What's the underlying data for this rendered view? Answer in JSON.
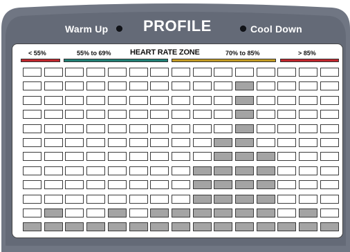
{
  "header": {
    "warm_up_label": "Warm Up",
    "title": "PROFILE",
    "cool_down_label": "Cool Down"
  },
  "zones": {
    "title": "HEART RATE ZONE",
    "items": [
      {
        "label": "< 55%",
        "color": "#c0252c"
      },
      {
        "label": "55% to 69%",
        "color": "#1f7f74"
      },
      {
        "label": "70% to 85%",
        "color": "#c29a22"
      },
      {
        "label": "> 85%",
        "color": "#c0252c"
      }
    ]
  },
  "profile": {
    "columns": 15,
    "rows": 12,
    "column_heights": [
      1,
      2,
      1,
      1,
      2,
      1,
      2,
      2,
      5,
      7,
      11,
      6,
      1,
      2,
      1
    ],
    "lit_color": "#a4a4a4",
    "unlit_color": "#ffffff"
  }
}
